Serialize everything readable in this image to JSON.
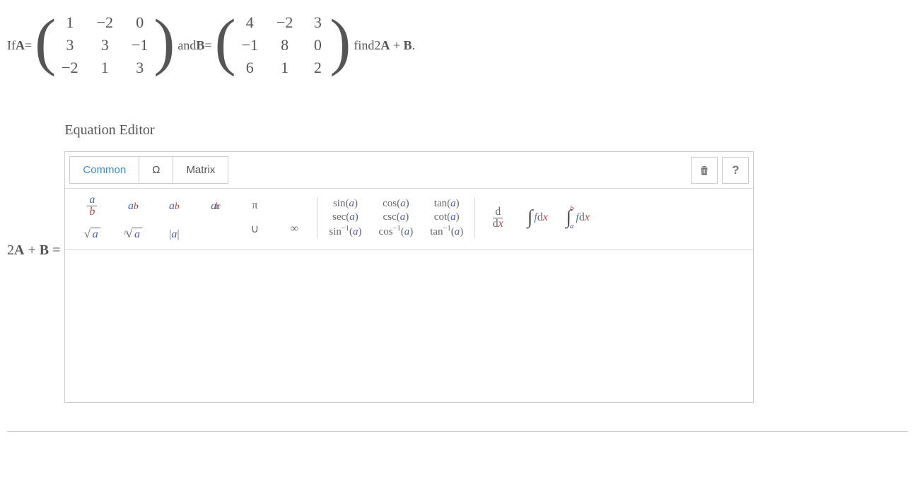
{
  "problem": {
    "prefix": "If ",
    "A_label": "A",
    "eq1": " = ",
    "matrixA": [
      [
        "1",
        "−2",
        "0"
      ],
      [
        "3",
        "3",
        "−1"
      ],
      [
        "−2",
        "1",
        "3"
      ]
    ],
    "mid": " and ",
    "B_label": "B",
    "eq2": " = ",
    "matrixB": [
      [
        "4",
        "−2",
        "3"
      ],
      [
        "−1",
        "8",
        "0"
      ],
      [
        "6",
        "1",
        "2"
      ]
    ],
    "suffix1": " find ",
    "expr": "2A + B",
    "suffix2": "."
  },
  "editor": {
    "title": "Equation Editor",
    "lhs": "2A + B =",
    "tabs": {
      "common": "Common",
      "omega": "Ω",
      "matrix": "Matrix"
    },
    "icons": {
      "trash": "trash-icon",
      "help": "?"
    },
    "palette": {
      "frac": {
        "top": "a",
        "bot": "b"
      },
      "pow": {
        "base": "a",
        "exp": "b"
      },
      "sub": {
        "base": "a",
        "sub": "b"
      },
      "subsup": {
        "base": "a",
        "sub": "b",
        "sup": "c"
      },
      "sqrt": {
        "in": "a"
      },
      "nroot": {
        "n": "n",
        "in": "a"
      },
      "abs": {
        "l": "|",
        "in": "a",
        "r": "|"
      },
      "pi": "π",
      "cup": "∪",
      "inf": "∞",
      "trig1": {
        "a": "sin(a)",
        "b": "sec(a)",
        "c": "sin⁻¹(a)"
      },
      "trig2": {
        "a": "cos(a)",
        "b": "csc(a)",
        "c": "cos⁻¹(a)"
      },
      "trig3": {
        "a": "tan(a)",
        "b": "cot(a)",
        "c": "tan⁻¹(a)"
      },
      "ddx": {
        "top": "d",
        "bot": "dx"
      },
      "int": {
        "sym": "∫",
        "f": "f",
        "dx": "dx"
      },
      "defint": {
        "sym": "∫",
        "a": "a",
        "b": "b",
        "f": "f",
        "dx": "dx"
      }
    }
  }
}
